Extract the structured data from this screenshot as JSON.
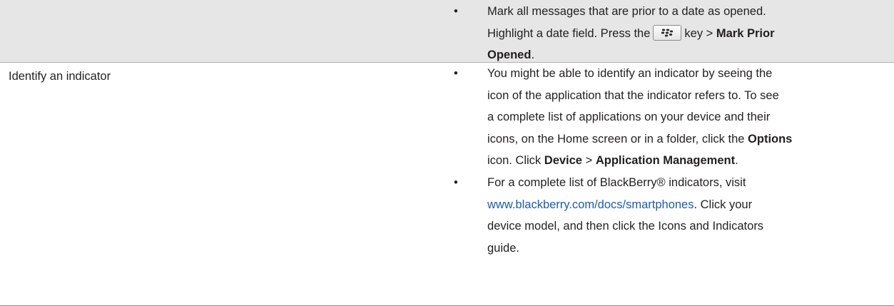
{
  "row1": {
    "bullet": "•",
    "item1": {
      "line1": "Mark all messages that are prior to a date as opened.",
      "line2_pre": "Highlight a date field. Press the",
      "key_icon": "blackberry-menu-key-icon",
      "line2_post": "key >",
      "line2_bold": "Mark Prior",
      "line3_bold": "Opened",
      "line3_post": "."
    }
  },
  "row2": {
    "label": "Identify an indicator",
    "bullet": "•",
    "item1": {
      "line1": "You might be able to identify an indicator by seeing the",
      "line2": "icon of the application that the indicator refers to. To see",
      "line3": "a complete list of applications on your device and their",
      "line4_pre": "icons, on the Home screen or in a folder, click the",
      "line4_bold": "Options",
      "line5_pre": "icon. Click",
      "line5_bold1": "Device",
      "line5_mid": ">",
      "line5_bold2": "Application Management",
      "line5_post": "."
    },
    "item2": {
      "line1": "For a complete list of BlackBerry® indicators, visit",
      "link": "www.blackberry.com/docs/smartphones",
      "line2_post": ". Click your",
      "line3": "device model, and then click the Icons and Indicators",
      "line4": "guide."
    }
  },
  "colors": {
    "shaded_row": "#e6e6e6",
    "link": "#1f5ba8",
    "text": "#231f20"
  }
}
